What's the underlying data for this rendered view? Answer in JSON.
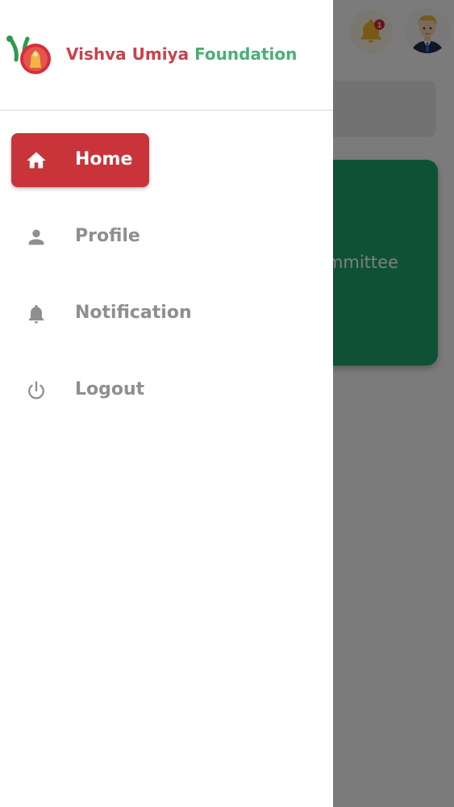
{
  "app": {
    "notification_count": "1",
    "committee_card_text": "mmittee"
  },
  "drawer": {
    "brand_part1": "Vishva Umiya",
    "brand_part2": "Foundation",
    "menu": [
      {
        "label": "Home",
        "icon": "home-icon",
        "active": true
      },
      {
        "label": "Profile",
        "icon": "person-icon",
        "active": false
      },
      {
        "label": "Notification",
        "icon": "bell-icon",
        "active": false
      },
      {
        "label": "Logout",
        "icon": "power-icon",
        "active": false
      }
    ]
  },
  "colors": {
    "brand_red": "#c8424a",
    "brand_green": "#4caf77",
    "active_item": "#c9343a",
    "card_green": "#1fa36b"
  }
}
